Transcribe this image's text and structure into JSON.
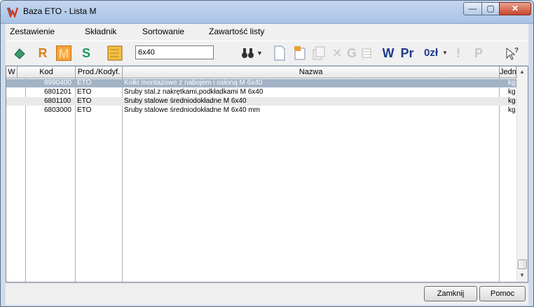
{
  "window": {
    "title": "Baza ETO - Lista M"
  },
  "menu": [
    {
      "label": "Zestawienie"
    },
    {
      "label": "Składnik"
    },
    {
      "label": "Sortowanie"
    },
    {
      "label": "Zawartość listy"
    }
  ],
  "toolbar": {
    "r_label": "R",
    "m_label": "M",
    "s_label": "S",
    "search_value": "6x40",
    "w_label": "W",
    "pr_label": "Pr",
    "zl_label": "0zł",
    "excl_label": "!",
    "p_label": "P",
    "g_label": "G"
  },
  "table": {
    "headers": [
      "W",
      "Kod",
      "Prod./Kodyf.",
      "Nazwa",
      "Jedn"
    ],
    "rows": [
      {
        "kod": "8990400",
        "prod": "ETO",
        "nazwa": "Kołki montażowe z nabojem i osłoną M 6x40",
        "jedn": "kg"
      },
      {
        "kod": "6801201",
        "prod": "ETO",
        "nazwa": "Śruby stal.z nakrętkami,podkładkami M 6x40",
        "jedn": "kg"
      },
      {
        "kod": "6801100",
        "prod": "ETO",
        "nazwa": "Śruby stalowe średniodokładne M  6x40",
        "jedn": "kg"
      },
      {
        "kod": "6803000",
        "prod": "ETO",
        "nazwa": "Śruby stalowe średniodokładne M  6x40 mm",
        "jedn": "kg"
      }
    ]
  },
  "buttons": {
    "zamknij": "Zamknij",
    "pomoc": "Pomoc"
  },
  "colors": {
    "selected_row": "#a3b3c6",
    "accent_orange": "#f4a23a",
    "green_s": "#1a9a5a",
    "blue_w": "#1b3a8c"
  }
}
